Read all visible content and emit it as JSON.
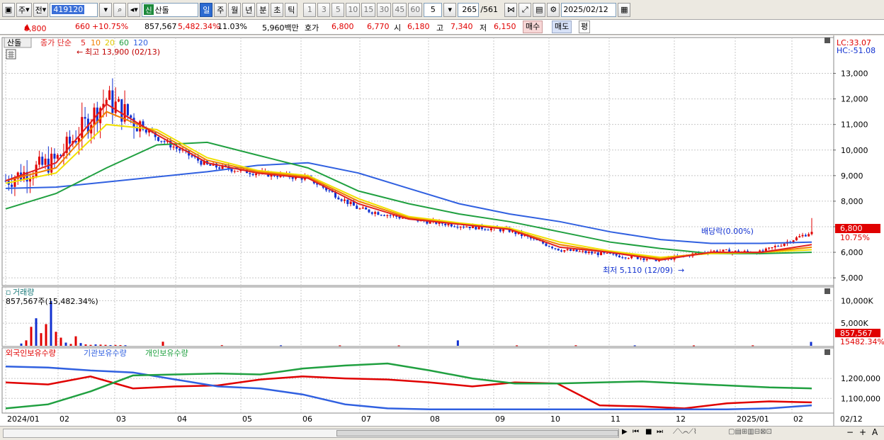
{
  "toolbar": {
    "market_label": "주",
    "prev_label": "전",
    "stock_code": "419120",
    "stock_name": "산돌",
    "new_badge": "신",
    "periods": [
      "일",
      "주",
      "월",
      "년",
      "분",
      "초",
      "틱"
    ],
    "selected_period": "일",
    "multiples": [
      "1",
      "3",
      "5",
      "10",
      "15",
      "30",
      "45",
      "60"
    ],
    "multiple_value": "5",
    "count_label": "265",
    "count_total": "/561",
    "date_value": "2025/02/12"
  },
  "quote": {
    "price": "6,800",
    "change": "660",
    "change_pct": "+10.75%",
    "volume": "857,567",
    "volume_ratio": "5,482.34%",
    "turnover_pct": "11.03%",
    "amount": "5,960백만",
    "bid_ask_label": "호가",
    "ask": "6,800",
    "bid": "6,770",
    "open_label": "시",
    "open": "6,180",
    "high_label": "고",
    "high": "7,340",
    "low_label": "저",
    "low": "6,150",
    "buy_label": "매수",
    "sell_label": "매도",
    "avg_label": "평"
  },
  "colors": {
    "up": "#e00000",
    "down": "#1030d0",
    "ma5": "#e02020",
    "ma10": "#f08000",
    "ma20": "#f0e000",
    "ma60": "#20a040",
    "ma120": "#3060e0",
    "foreign": "#e00000",
    "institution": "#3060e0",
    "individual": "#20a040"
  },
  "price_panel": {
    "name_tag": "산돌",
    "legend_prefix": "종가 단순",
    "ma_periods": [
      "5",
      "10",
      "20",
      "60",
      "120"
    ],
    "lc": "LC:33.07",
    "hc": "HC:-51.08",
    "max_note": "최고 13,900 (02/13)",
    "min_note": "최저 5,110 (12/09)",
    "dividend_note": "배당락(0.00%)",
    "last_price_tag": "6,800",
    "last_pct_tag": "10.75%"
  },
  "volume_panel": {
    "title": "거래량",
    "info": "857,567주(15,482.34%)",
    "last_tag": "857,567",
    "last_pct_tag": "15482.34%"
  },
  "holdings_panel": {
    "series_names": [
      "외국인보유수량",
      "기관보유수량",
      "개인보유수량"
    ]
  },
  "x_axis": {
    "labels": [
      "2024/01",
      "02",
      "03",
      "04",
      "05",
      "06",
      "07",
      "08",
      "09",
      "10",
      "11",
      "12",
      "2025/01",
      "02"
    ],
    "last_date": "02/12"
  },
  "chart_data": [
    {
      "type": "candlestick",
      "y_ticks": [
        5000,
        6000,
        7000,
        8000,
        9000,
        10000,
        11000,
        12000,
        13000
      ],
      "ylim": [
        4700,
        14400
      ],
      "dates": [
        "2024/01",
        "02",
        "03",
        "04",
        "05",
        "06",
        "07",
        "08",
        "09",
        "10",
        "11",
        "12",
        "2025/01",
        "02"
      ],
      "close": [
        8800,
        9600,
        12000,
        10500,
        9400,
        9100,
        8900,
        7700,
        7300,
        7050,
        6850,
        6100,
        5900,
        5700,
        6050,
        6000,
        6800
      ],
      "ma120_path_note": "",
      "ma": {
        "5": [
          8800,
          9500,
          11800,
          10600,
          9500,
          9100,
          8900,
          7900,
          7300,
          7100,
          6900,
          6200,
          6000,
          5700,
          6000,
          6000,
          6300
        ],
        "10": [
          8800,
          9300,
          11500,
          10700,
          9600,
          9150,
          8950,
          8000,
          7350,
          7100,
          6900,
          6300,
          6000,
          5750,
          6000,
          6000,
          6200
        ],
        "20": [
          8700,
          9100,
          11000,
          10800,
          9700,
          9200,
          9000,
          8100,
          7400,
          7150,
          6950,
          6400,
          6050,
          5800,
          5950,
          6000,
          6100
        ],
        "60": [
          7700,
          8300,
          9300,
          10200,
          10300,
          9800,
          9300,
          8400,
          7900,
          7500,
          7200,
          6800,
          6400,
          6150,
          5950,
          5950,
          6000
        ],
        "120": [
          8500,
          8550,
          8750,
          8950,
          9150,
          9400,
          9500,
          9100,
          8500,
          7900,
          7500,
          7200,
          6800,
          6500,
          6350,
          6350,
          6400
        ]
      }
    },
    {
      "type": "bar",
      "y_ticks": [
        5000,
        10000
      ],
      "ylim": [
        0,
        11000
      ],
      "units": "K",
      "values": [
        500,
        1200,
        4200,
        6100,
        2800,
        4800,
        9900,
        3100,
        1800,
        700,
        400,
        2100,
        600,
        300,
        200,
        300,
        250,
        200,
        150,
        180,
        150,
        120,
        900,
        130,
        100,
        90,
        80,
        1200,
        90,
        110,
        90,
        80,
        100,
        857.567
      ]
    },
    {
      "type": "line",
      "y_ticks": [
        1100000,
        1200000
      ],
      "ylim": [
        1030000,
        1300000
      ],
      "series": [
        {
          "name": "외국인보유수량",
          "values": [
            1180000,
            1170000,
            1210000,
            1150000,
            1160000,
            1165000,
            1195000,
            1210000,
            1200000,
            1195000,
            1180000,
            1160000,
            1180000,
            1175000,
            1065000,
            1060000,
            1050000,
            1075000,
            1085000,
            1080000
          ]
        },
        {
          "name": "기관보유수량",
          "values": [
            1260000,
            1255000,
            1240000,
            1230000,
            1195000,
            1160000,
            1150000,
            1120000,
            1070000,
            1050000,
            1045000,
            1045000,
            1045000,
            1045000,
            1045000,
            1045000,
            1045000,
            1045000,
            1050000,
            1065000
          ]
        },
        {
          "name": "개인보유수량",
          "values": [
            1050000,
            1070000,
            1135000,
            1215000,
            1220000,
            1225000,
            1220000,
            1250000,
            1265000,
            1275000,
            1240000,
            1200000,
            1175000,
            1175000,
            1180000,
            1185000,
            1175000,
            1165000,
            1155000,
            1150000
          ]
        }
      ]
    }
  ]
}
